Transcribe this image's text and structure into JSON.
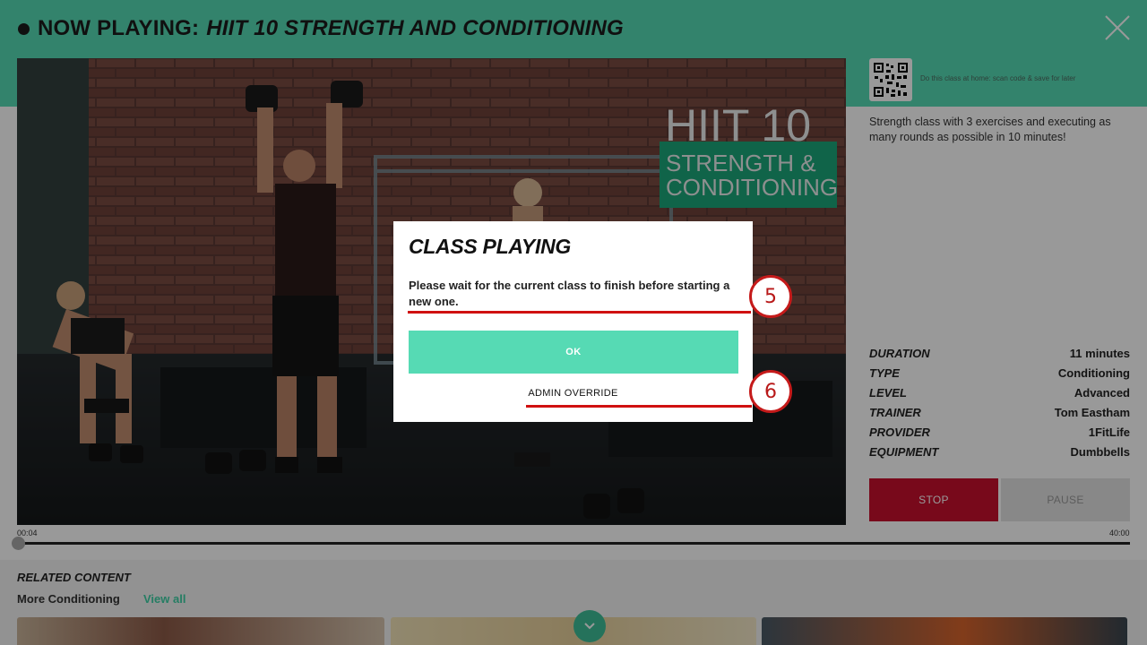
{
  "header": {
    "prefix": "NOW PLAYING:",
    "title": "HIIT 10 STRENGTH AND CONDITIONING",
    "close_icon": "close-icon"
  },
  "video": {
    "overlay_line1": "HIIT 10",
    "overlay_line2": "STRENGTH &",
    "overlay_line3": "CONDITIONING"
  },
  "side": {
    "qr_caption": "Do this class at home: scan code & save for later",
    "description": "Strength class with 3 exercises and executing as many rounds as possible in 10 minutes!",
    "details": [
      {
        "key": "DURATION",
        "value": "11 minutes"
      },
      {
        "key": "TYPE",
        "value": "Conditioning"
      },
      {
        "key": "LEVEL",
        "value": "Advanced"
      },
      {
        "key": "TRAINER",
        "value": "Tom Eastham"
      },
      {
        "key": "PROVIDER",
        "value": "1FitLife"
      },
      {
        "key": "EQUIPMENT",
        "value": "Dumbbells"
      }
    ],
    "stop_label": "STOP",
    "pause_label": "PAUSE"
  },
  "progress": {
    "elapsed": "00:04",
    "total": "40:00",
    "fraction": 0.0017
  },
  "related": {
    "title": "RELATED CONTENT",
    "category": "More Conditioning",
    "view_all": "View all"
  },
  "modal": {
    "title": "CLASS PLAYING",
    "message": "Please wait for the current class to finish before starting a new one.",
    "ok_label": "OK",
    "admin_label": "ADMIN OVERRIDE"
  },
  "annotations": {
    "marker_5": "5",
    "marker_6": "6"
  },
  "colors": {
    "accent": "#56dab4",
    "stop": "#c8102e",
    "annotation": "#d01010"
  }
}
